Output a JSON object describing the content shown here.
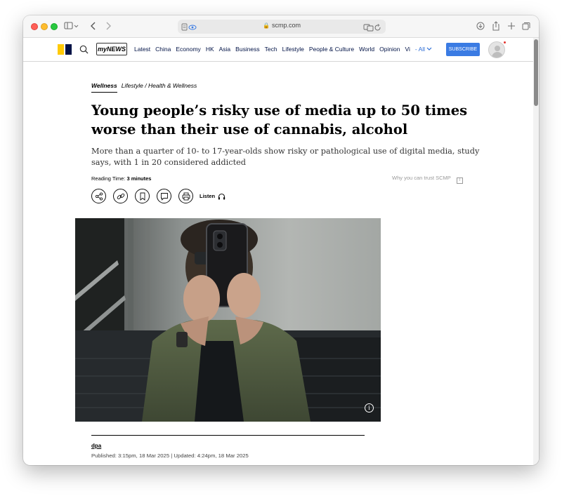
{
  "browser": {
    "url": "scmp.com"
  },
  "site": {
    "mynews_label": "myNEWS",
    "nav_items": [
      "Latest",
      "China",
      "Economy",
      "HK",
      "Asia",
      "Business",
      "Tech",
      "Lifestyle",
      "People & Culture",
      "World",
      "Opinion",
      "Vi"
    ],
    "nav_all": "- All",
    "subscribe": "SUBSCRIBE",
    "brand_colors": {
      "yellow": "#ffca05",
      "navy": "#001246",
      "subscribe_blue": "#3a7be3"
    }
  },
  "article": {
    "section": "Wellness",
    "breadcrumb": "Lifestyle / Health & Wellness",
    "headline": "Young people’s risky use of media up to 50 times worse than their use of cannabis, alcohol",
    "subheadline": "More than a quarter of 10- to 17-year-olds show risky or pathological use of digital media, study says, with 1 in 20 considered addicted",
    "reading_time_label": "Reading Time:",
    "reading_time_value": "3 minutes",
    "trust_label": "Why you can trust SCMP",
    "listen_label": "Listen",
    "author": "dpa",
    "published": "Published: 3:15pm, 18 Mar 2025 | Updated: 4:24pm, 18 Mar 2025"
  },
  "icons": [
    "share-icon",
    "link-icon",
    "bookmark-icon",
    "comment-icon",
    "print-icon",
    "headphones-icon",
    "search-icon",
    "info-icon"
  ]
}
